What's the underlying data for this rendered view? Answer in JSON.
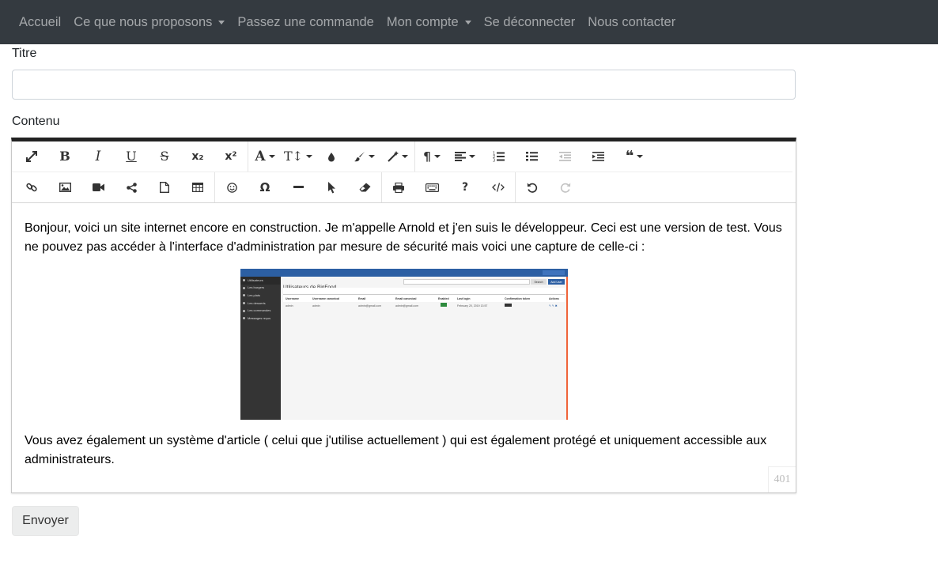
{
  "navbar": {
    "items": [
      {
        "label": "Accueil",
        "dropdown": false
      },
      {
        "label": "Ce que nous proposons",
        "dropdown": true
      },
      {
        "label": "Passez une commande",
        "dropdown": false
      },
      {
        "label": "Mon compte",
        "dropdown": true
      },
      {
        "label": "Se déconnecter",
        "dropdown": false
      },
      {
        "label": "Nous contacter",
        "dropdown": false
      }
    ],
    "background": "#343a40"
  },
  "form": {
    "title_label": "Titre",
    "title_value": "",
    "content_label": "Contenu",
    "submit_label": "Envoyer"
  },
  "editor": {
    "toolbar_row1": [
      "fullscreen-icon",
      "bold-icon",
      "italic-icon",
      "underline-icon",
      "strikethrough-icon",
      "subscript-icon",
      "superscript-icon",
      "font-family-icon",
      "font-size-icon",
      "color-icon",
      "paint-brush-icon",
      "magic-icon",
      "paragraph-icon",
      "align-icon",
      "ordered-list-icon",
      "unordered-list-icon",
      "outdent-icon",
      "indent-icon",
      "quote-icon"
    ],
    "toolbar_row2": [
      "link-icon",
      "image-icon",
      "video-icon",
      "share-icon",
      "file-icon",
      "table-icon",
      "emoji-icon",
      "special-char-icon",
      "horizontal-line-icon",
      "select-icon",
      "eraser-icon",
      "print-icon",
      "keyboard-icon",
      "help-icon",
      "code-view-icon",
      "undo-icon",
      "redo-icon"
    ],
    "paragraph1": "Bonjour, voici un site internet encore en construction. Je m'appelle Arnold et j'en suis le développeur. Ceci est une version de test. Vous ne pouvez pas accéder à l'interface d'administration par mesure de sécurité mais voici une capture de celle-ci :",
    "paragraph2": "Vous avez également un système d'article ( celui que j'utilise actuellement ) qui est également protégé et uniquement accessible aux administrateurs.",
    "char_counter": "401"
  },
  "embedded_screenshot": {
    "brand": "Big Food",
    "page_heading": "Utilisateurs de BigFood",
    "search_button": "Search",
    "add_button": "Add User",
    "sidebar": [
      "Utilisateurs",
      "Les burgers",
      "Les plats",
      "Les desserts",
      "Les commandes",
      "Messages reçus"
    ],
    "table_headers": [
      "Username",
      "Username canonical",
      "Email",
      "Email canonical",
      "Enabled",
      "Last login",
      "Confirmation token",
      "Actions"
    ],
    "table_row": [
      "admin",
      "admin",
      "admin@gmail.com",
      "admin@gmail.com",
      "",
      "February 20, 2019 13:57",
      "",
      ""
    ]
  },
  "colors": {
    "accent_blue": "#2c5fa3",
    "editor_top_border": "#222222"
  }
}
